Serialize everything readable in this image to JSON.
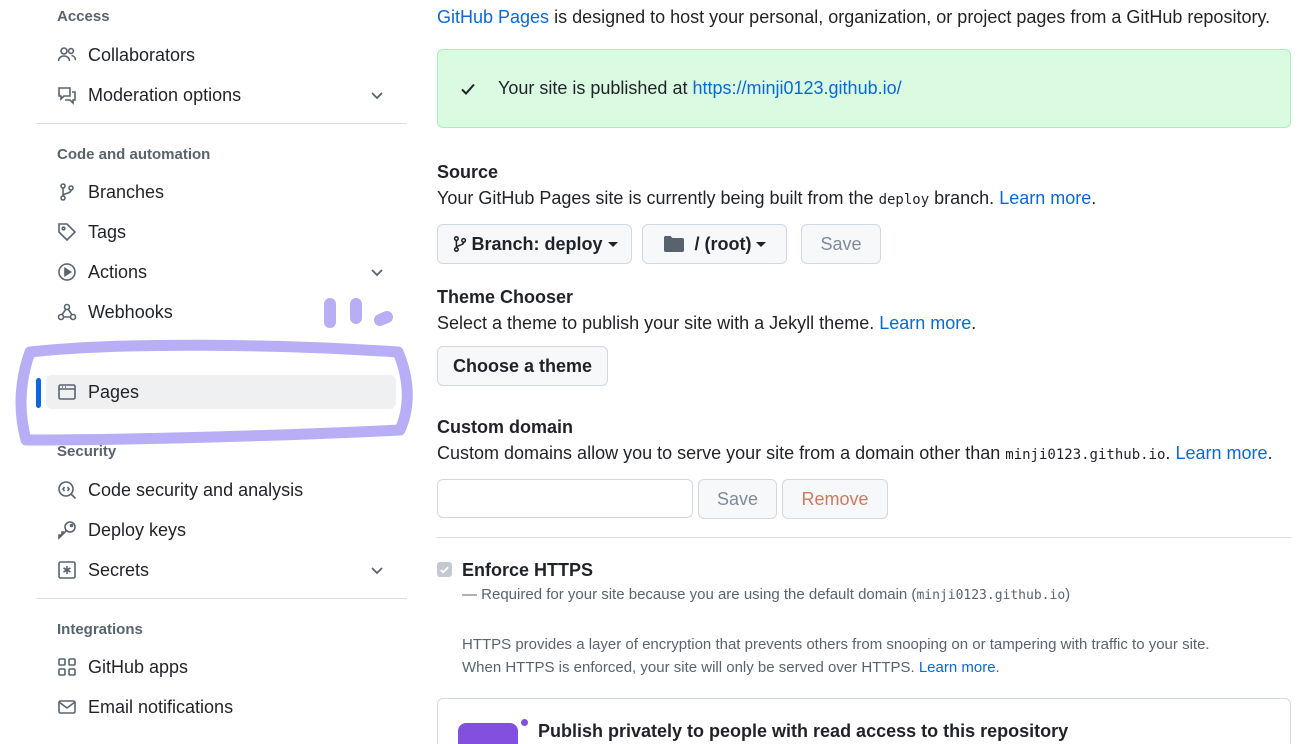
{
  "sidebar": {
    "groups": {
      "access": "Access",
      "code_automation": "Code and automation",
      "security": "Security",
      "integrations": "Integrations"
    },
    "items": {
      "collaborators": "Collaborators",
      "moderation": "Moderation options",
      "branches": "Branches",
      "tags": "Tags",
      "actions": "Actions",
      "webhooks": "Webhooks",
      "pages": "Pages",
      "code_security": "Code security and analysis",
      "deploy_keys": "Deploy keys",
      "secrets": "Secrets",
      "github_apps": "GitHub apps",
      "email_notifications": "Email notifications"
    },
    "active_item": "Pages"
  },
  "main": {
    "intro_link": "GitHub Pages",
    "intro_text": " is designed to host your personal, organization, or project pages from a GitHub repository.",
    "flash": {
      "text": "Your site is published at ",
      "url": "https://minji0123.github.io/"
    },
    "source": {
      "title": "Source",
      "desc_before": "Your GitHub Pages site is currently being built from the ",
      "branch_code": "deploy",
      "desc_after": " branch. ",
      "learn_more": "Learn more",
      "branch_button": "Branch: deploy",
      "folder_button": "/ (root)",
      "save_button": "Save"
    },
    "theme": {
      "title": "Theme Chooser",
      "desc": "Select a theme to publish your site with a Jekyll theme. ",
      "learn_more": "Learn more",
      "button": "Choose a theme"
    },
    "custom_domain": {
      "title": "Custom domain",
      "desc_before": "Custom domains allow you to serve your site from a domain other than ",
      "domain_code": "minji0123.github.io",
      "desc_after": ". ",
      "learn_more": "Learn more",
      "input_value": "",
      "save_button": "Save",
      "remove_button": "Remove"
    },
    "https": {
      "title": "Enforce HTTPS",
      "checked": true,
      "required_before": "— Required for your site because you are using the default domain (",
      "required_code": "minji0123.github.io",
      "required_after": ")",
      "info_line1": "HTTPS provides a layer of encryption that prevents others from snooping on or tampering with traffic to your site.",
      "info_line2": "When HTTPS is enforced, your site will only be served over HTTPS. ",
      "learn_more": "Learn more"
    },
    "private": {
      "title": "Publish privately to people with read access to this repository"
    }
  },
  "colors": {
    "accent": "#0969da",
    "success_bg": "#dafbe1",
    "annotation": "#b7aef5",
    "danger_muted": "#d1785e"
  }
}
